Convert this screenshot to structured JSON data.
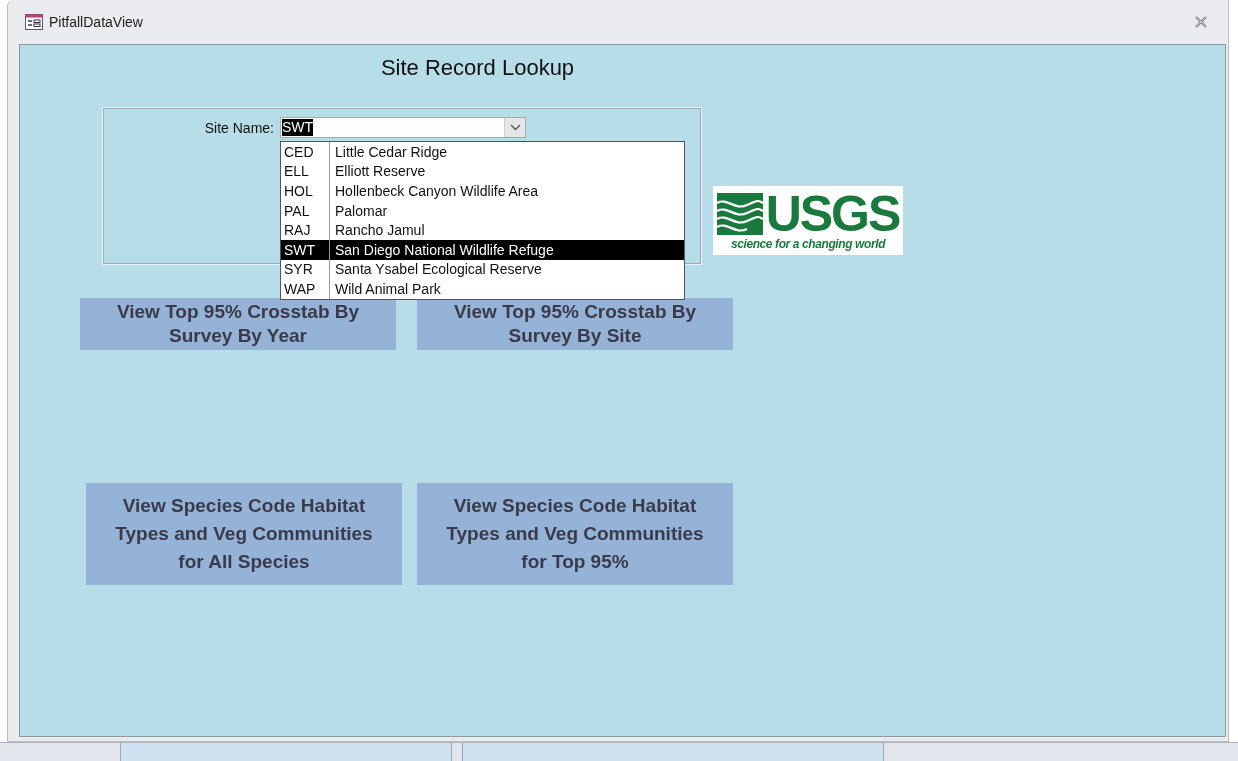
{
  "window": {
    "title": "PitfallDataView"
  },
  "form": {
    "title": "Site Record Lookup",
    "site_field": {
      "label": "Site Name:",
      "value": "SWT",
      "expanded": true
    },
    "dropdown": [
      {
        "code": "CED",
        "name": "Little Cedar Ridge",
        "selected": false
      },
      {
        "code": "ELL",
        "name": "Elliott Reserve",
        "selected": false
      },
      {
        "code": "HOL",
        "name": "Hollenbeck Canyon Wildlife Area",
        "selected": false
      },
      {
        "code": "PAL",
        "name": "Palomar",
        "selected": false
      },
      {
        "code": "RAJ",
        "name": "Rancho Jamul",
        "selected": false
      },
      {
        "code": "SWT",
        "name": "San Diego National Wildlife Refuge",
        "selected": true
      },
      {
        "code": "SYR",
        "name": "Santa Ysabel Ecological Reserve",
        "selected": false
      },
      {
        "code": "WAP",
        "name": "Wild Animal Park",
        "selected": false
      }
    ],
    "logo": {
      "wordmark": "USGS",
      "tagline": "science for a changing world"
    },
    "buttons": [
      "View Top 95% Crosstab By Survey By Year",
      "View Top 95% Crosstab By Survey By Site",
      "View Species Code Habitat Types and Veg Communities for All Species",
      "View Species Code Habitat Types and Veg Communities for Top 95%"
    ]
  }
}
